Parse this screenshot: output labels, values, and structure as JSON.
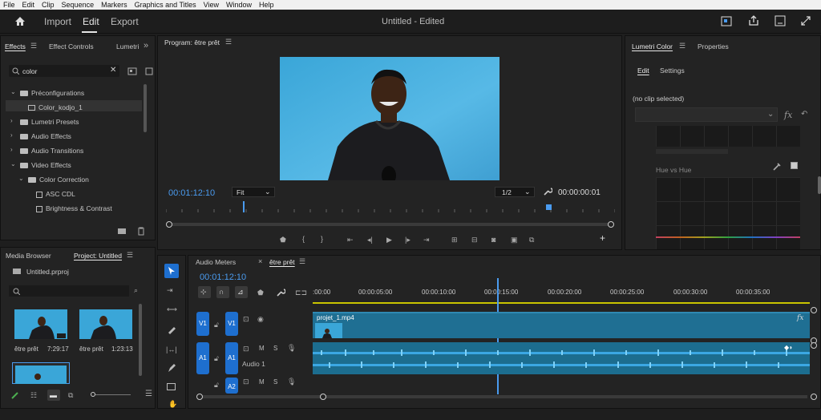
{
  "menu": [
    "File",
    "Edit",
    "Clip",
    "Sequence",
    "Markers",
    "Graphics and Titles",
    "View",
    "Window",
    "Help"
  ],
  "workspace": {
    "import": "Import",
    "edit": "Edit",
    "export": "Export",
    "title": "Untitled - Edited"
  },
  "effects_panel": {
    "tabs": [
      "Effects",
      "Effect Controls",
      "Lumetri"
    ],
    "search_value": "color",
    "tree": [
      {
        "label": "Préconfigurations"
      },
      {
        "label": "Color_kodjo_1"
      },
      {
        "label": "Lumetri Presets"
      },
      {
        "label": "Audio Effects"
      },
      {
        "label": "Audio Transitions"
      },
      {
        "label": "Video Effects"
      },
      {
        "label": "Color Correction"
      },
      {
        "label": "ASC CDL"
      },
      {
        "label": "Brightness & Contrast"
      }
    ]
  },
  "program_monitor": {
    "title": "Program: être prêt",
    "timecode": "00:01:12:10",
    "fit": "Fit",
    "resolution": "1/2",
    "duration": "00:00:00:01"
  },
  "lumetri": {
    "tabs": [
      "Lumetri Color",
      "Properties"
    ],
    "subtabs": [
      "Edit",
      "Settings"
    ],
    "no_clip": "(no clip selected)",
    "fx": "fx",
    "hue_label": "Hue vs Hue"
  },
  "project_panel": {
    "tabs": [
      "Media Browser",
      "Project: Untitled"
    ],
    "file": "Untitled.prproj",
    "clips": [
      {
        "name": "être prêt",
        "duration": "7:29:17"
      },
      {
        "name": "être prêt",
        "duration": "1:23:13"
      }
    ]
  },
  "timeline": {
    "tabs": [
      "Audio Meters",
      "être prêt"
    ],
    "timecode": "00:01:12:10",
    "ruler": [
      ":00:00",
      "00:00:05:00",
      "00:00:10:00",
      "00:00:15:00",
      "00:00:20:00",
      "00:00:25:00",
      "00:00:30:00",
      "00:00:35:00"
    ],
    "clip_name": "projet_1.mp4",
    "audio_label": "Audio 1",
    "tracks": {
      "v1": "V1",
      "a1": "A1",
      "a2": "A2",
      "m": "M",
      "s": "S"
    }
  },
  "colors": {
    "accent": "#4a9bef",
    "clip": "#1f6f93",
    "track_btn": "#1e6fcf"
  }
}
